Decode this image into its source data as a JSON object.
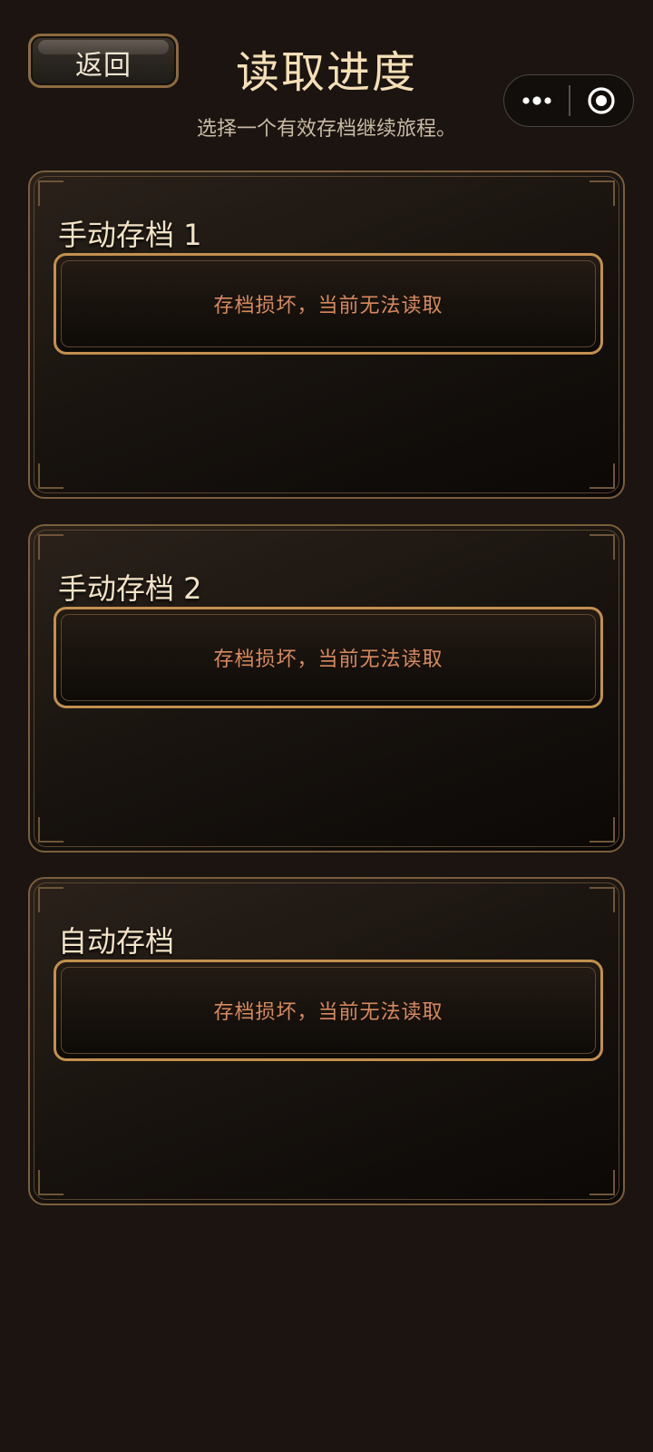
{
  "header": {
    "back_label": "返回",
    "title": "读取进度",
    "subtitle": "选择一个有效存档继续旅程。"
  },
  "capsule": {
    "more_icon": "more-dots-icon",
    "close_icon": "target-circle-icon"
  },
  "slots": [
    {
      "title": "手动存档 1",
      "status": "存档损坏，当前无法读取"
    },
    {
      "title": "手动存档 2",
      "status": "存档损坏，当前无法读取"
    },
    {
      "title": "自动存档",
      "status": "存档损坏，当前无法读取"
    }
  ],
  "colors": {
    "background": "#1b1410",
    "accent_gold": "#c2904f",
    "title_text": "#f5dfb6",
    "error_text": "#d78a5e"
  }
}
